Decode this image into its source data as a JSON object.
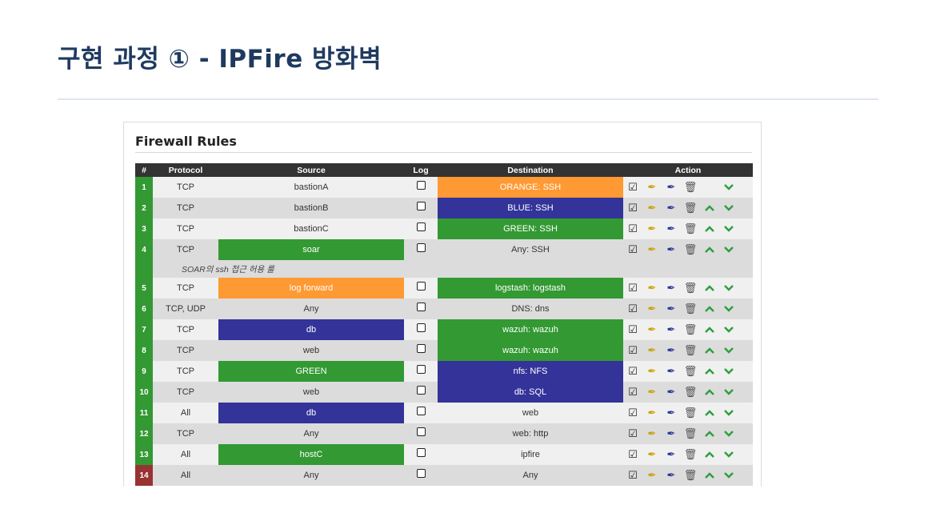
{
  "slide": {
    "title": "구현 과정 ① - IPFire 방화벽"
  },
  "panel": {
    "title": "Firewall Rules"
  },
  "headers": {
    "num": "#",
    "protocol": "Protocol",
    "source": "Source",
    "log": "Log",
    "destination": "Destination",
    "action": "Action"
  },
  "note": {
    "text": "SOAR의 ssh 접근 허용 룰"
  },
  "colors": {
    "orange": "#ff9933",
    "blue": "#333399",
    "green": "#339933",
    "red": "#993333",
    "header": "#333333"
  },
  "rows": [
    {
      "num": "1",
      "protocol": "TCP",
      "source": "bastionA",
      "source_color": "",
      "destination": "ORANGE: SSH",
      "destination_color": "orange"
    },
    {
      "num": "2",
      "protocol": "TCP",
      "source": "bastionB",
      "source_color": "",
      "destination": "BLUE: SSH",
      "destination_color": "blue"
    },
    {
      "num": "3",
      "protocol": "TCP",
      "source": "bastionC",
      "source_color": "",
      "destination": "GREEN: SSH",
      "destination_color": "green"
    },
    {
      "num": "4",
      "protocol": "TCP",
      "source": "soar",
      "source_color": "green",
      "destination": "Any: SSH",
      "destination_color": ""
    },
    {
      "num": "5",
      "protocol": "TCP",
      "source": "log forward",
      "source_color": "orange",
      "destination": "logstash: logstash",
      "destination_color": "green"
    },
    {
      "num": "6",
      "protocol": "TCP, UDP",
      "source": "Any",
      "source_color": "",
      "destination": "DNS: dns",
      "destination_color": ""
    },
    {
      "num": "7",
      "protocol": "TCP",
      "source": "db",
      "source_color": "blue",
      "destination": "wazuh: wazuh",
      "destination_color": "green"
    },
    {
      "num": "8",
      "protocol": "TCP",
      "source": "web",
      "source_color": "",
      "destination": "wazuh: wazuh",
      "destination_color": "green"
    },
    {
      "num": "9",
      "protocol": "TCP",
      "source": "GREEN",
      "source_color": "green",
      "destination": "nfs: NFS",
      "destination_color": "blue"
    },
    {
      "num": "10",
      "protocol": "TCP",
      "source": "web",
      "source_color": "",
      "destination": "db: SQL",
      "destination_color": "blue"
    },
    {
      "num": "11",
      "protocol": "All",
      "source": "db",
      "source_color": "blue",
      "destination": "web",
      "destination_color": ""
    },
    {
      "num": "12",
      "protocol": "TCP",
      "source": "Any",
      "source_color": "",
      "destination": "web: http",
      "destination_color": ""
    },
    {
      "num": "13",
      "protocol": "All",
      "source": "hostC",
      "source_color": "green",
      "destination": "ipfire",
      "destination_color": ""
    },
    {
      "num": "14",
      "protocol": "All",
      "source": "Any",
      "source_color": "",
      "destination": "Any",
      "destination_color": "",
      "num_color": "red"
    }
  ],
  "icons": {
    "toggle": "checkbox-checked-icon",
    "edit": "pencil-icon",
    "copy": "pencil-plus-icon",
    "delete": "trash-icon",
    "up": "chevron-up-icon",
    "down": "chevron-down-icon"
  }
}
